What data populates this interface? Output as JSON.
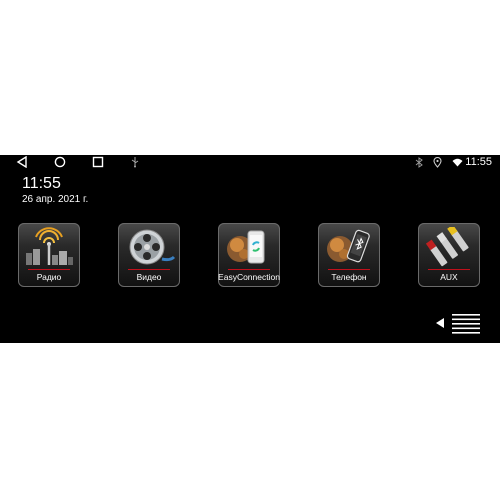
{
  "status": {
    "time": "11:55"
  },
  "home": {
    "clock": "11:55",
    "date": "26 апр. 2021 г."
  },
  "apps": [
    {
      "id": "radio",
      "label": "Радио",
      "icon": "radio-tower-icon"
    },
    {
      "id": "video",
      "label": "Видео",
      "icon": "film-reel-icon"
    },
    {
      "id": "easyconnection",
      "label": "EasyConnection",
      "icon": "phone-link-icon"
    },
    {
      "id": "phone",
      "label": "Телефон",
      "icon": "bluetooth-phone-icon"
    },
    {
      "id": "aux",
      "label": "AUX",
      "icon": "rca-cable-icon"
    }
  ],
  "colors": {
    "background": "#000000",
    "accent_line": "#c0101b"
  }
}
